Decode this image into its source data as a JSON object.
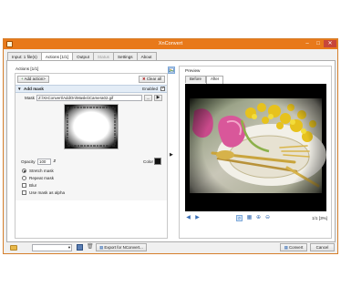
{
  "window": {
    "title": "XnConvert"
  },
  "tabs": [
    {
      "label": "Input: 1 file(s)"
    },
    {
      "label": "Actions [1/1]"
    },
    {
      "label": "Output"
    },
    {
      "label": "Status"
    },
    {
      "label": "Settings"
    },
    {
      "label": "About"
    }
  ],
  "actions": {
    "header": "Actions [1/1]",
    "add_action": "Add action>",
    "clear_all": "Clear all",
    "mask": {
      "title": "Add mask",
      "enabled_label": "Enabled",
      "enabled": true,
      "mask_label": "Mask",
      "mask_path": "Z:\\XnConvert\\AddOn\\Masks\\Camera02.gif",
      "browse_label": "...",
      "opacity_label": "Opacity",
      "opacity_value": "100",
      "color_label": "Color",
      "color_value": "#111111",
      "options": [
        {
          "label": "Stretch mask",
          "type": "radio",
          "checked": true
        },
        {
          "label": "Repeat mask",
          "type": "radio",
          "checked": false
        },
        {
          "label": "Blur",
          "type": "checkbox",
          "checked": false
        },
        {
          "label": "Use mask as alpha",
          "type": "checkbox",
          "checked": false
        }
      ]
    }
  },
  "preview": {
    "header": "Preview",
    "tabs": [
      {
        "label": "Before"
      },
      {
        "label": "After"
      }
    ],
    "active_tab": "After",
    "page_indicator": "1/1 [3%]"
  },
  "footer": {
    "preset_value": "",
    "export_label": "Export for NConvert...",
    "convert_label": "Convert",
    "cancel_label": "Cancel"
  },
  "colors": {
    "titlebar": "#e8791a",
    "accent": "#3a6fb6"
  }
}
